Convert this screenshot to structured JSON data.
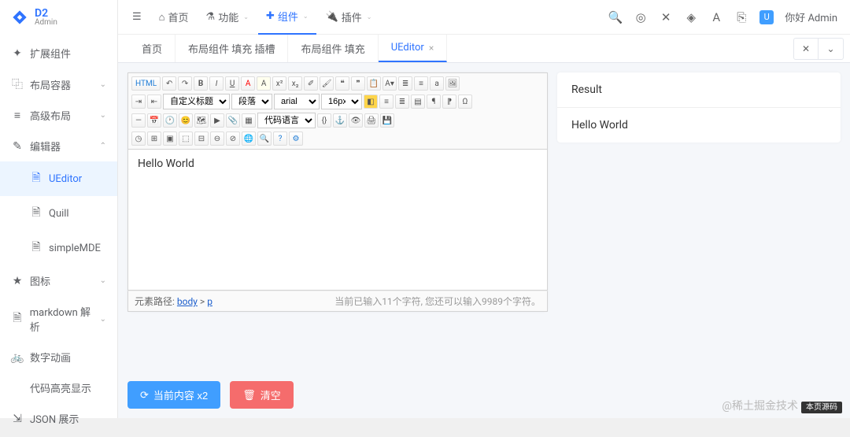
{
  "brand": {
    "title": "D2",
    "subtitle": "Admin"
  },
  "sidebar": {
    "items": [
      {
        "icon": "✦",
        "label": "扩展组件"
      },
      {
        "icon": "⿻",
        "label": "布局容器",
        "chev": "⌄"
      },
      {
        "icon": "≡",
        "label": "高级布局",
        "chev": "⌄"
      },
      {
        "icon": "✎",
        "label": "编辑器",
        "chev": "⌃",
        "expanded": true
      },
      {
        "icon": "🗎",
        "label": "UEditor",
        "sub": true,
        "active": true
      },
      {
        "icon": "🗎",
        "label": "Quill",
        "sub": true
      },
      {
        "icon": "🗎",
        "label": "simpleMDE",
        "sub": true
      },
      {
        "icon": "★",
        "label": "图标",
        "chev": "⌄"
      },
      {
        "icon": "🗎",
        "label": "markdown 解析",
        "chev": "⌄"
      },
      {
        "icon": "🚲",
        "label": "数字动画"
      },
      {
        "icon": "</>",
        "label": "代码高亮显示"
      },
      {
        "icon": "⇲",
        "label": "JSON 展示"
      }
    ]
  },
  "topbar": {
    "items": [
      {
        "icon": "☰",
        "label": "",
        "name": "menu-toggle"
      },
      {
        "icon": "⌂",
        "label": "首页",
        "name": "nav-home"
      },
      {
        "icon": "⚗",
        "label": "功能",
        "name": "nav-features",
        "chev": true
      },
      {
        "icon": "✚",
        "label": "组件",
        "name": "nav-components",
        "chev": true,
        "active": true
      },
      {
        "icon": "🔌",
        "label": "插件",
        "name": "nav-plugins",
        "chev": true
      }
    ],
    "right_icons": [
      {
        "glyph": "🔍",
        "name": "search-icon"
      },
      {
        "glyph": "◎",
        "name": "target-icon"
      },
      {
        "glyph": "✕",
        "name": "fullscreen-icon"
      },
      {
        "glyph": "◈",
        "name": "gem-icon"
      },
      {
        "glyph": "A",
        "name": "font-icon"
      },
      {
        "glyph": "⎘",
        "name": "lang-icon"
      }
    ],
    "greeting": "你好 Admin"
  },
  "tabs": [
    {
      "label": "首页"
    },
    {
      "label": "布局组件 填充 插槽"
    },
    {
      "label": "布局组件 填充"
    },
    {
      "label": "UEditor",
      "active": true,
      "closable": true
    }
  ],
  "editor": {
    "selects": {
      "heading": "自定义标题",
      "paragraph": "段落",
      "font": "arial",
      "size": "16px",
      "codelang": "代码语言"
    },
    "content": "Hello World",
    "path_label": "元素路径:",
    "path_body": "body",
    "path_sep": ">",
    "path_p": "p",
    "counter": "当前已输入11个字符, 您还可以输入9989个字符。"
  },
  "result": {
    "title": "Result",
    "body": "Hello World"
  },
  "actions": {
    "current": "当前内容 x2",
    "clear": "清空"
  },
  "watermark": {
    "text": "@稀土掘金技术",
    "tag": "本页源码"
  }
}
